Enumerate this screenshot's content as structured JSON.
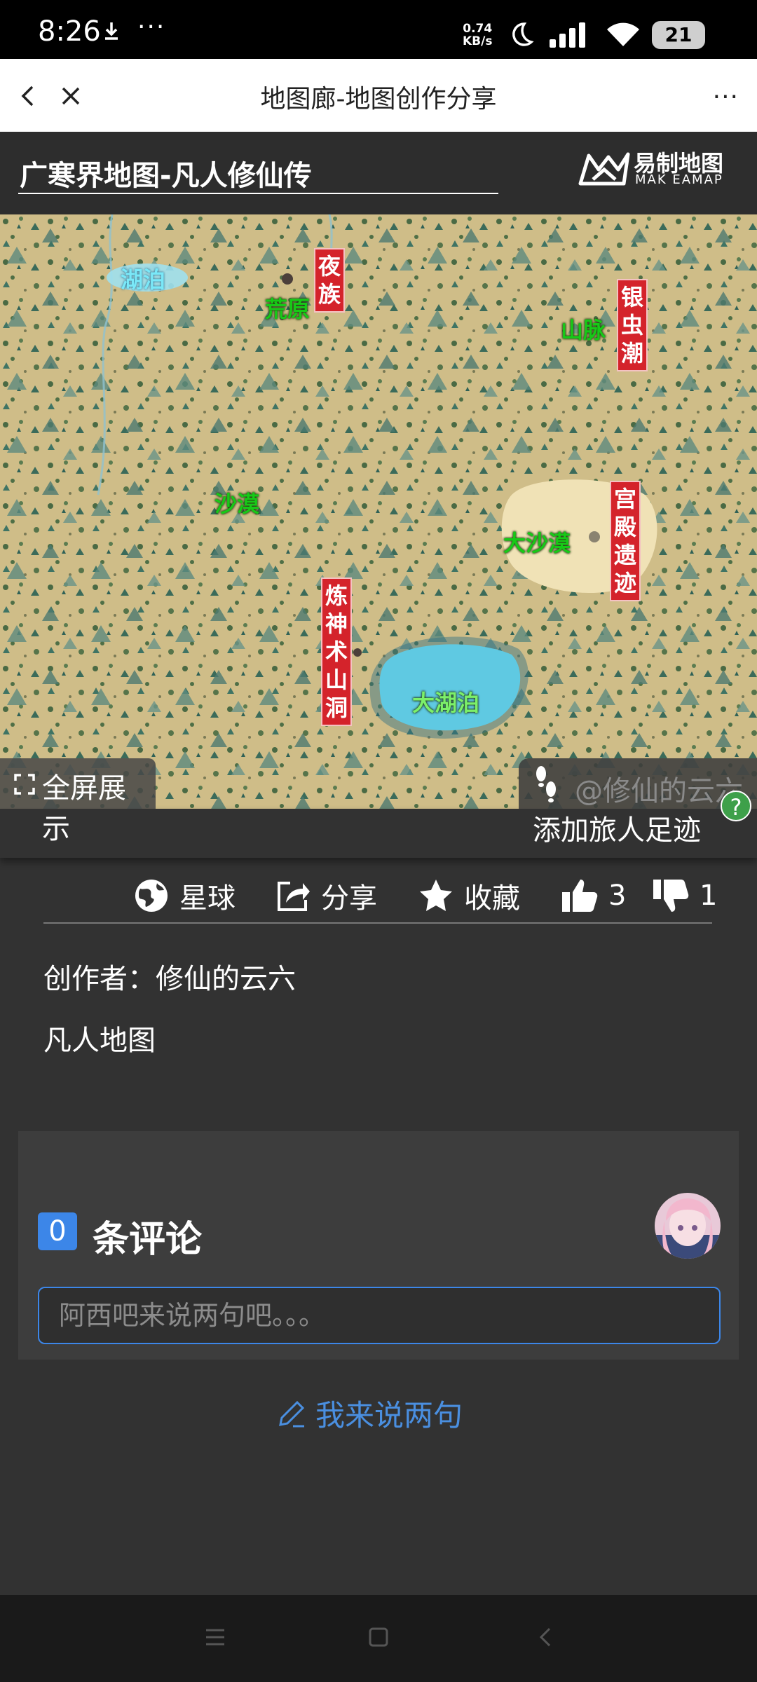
{
  "status_bar": {
    "time": "8:26",
    "net_speed_value": "0.74",
    "net_speed_unit": "KB/s",
    "battery": "21"
  },
  "nav": {
    "title": "地图廊-地图创作分享",
    "more": "···"
  },
  "map_header": {
    "title": "广寒界地图-凡人修仙传",
    "logo_cn": "易制地图",
    "logo_en": "MAK EAMAP"
  },
  "map_labels": {
    "lake_small": "湖泊",
    "wasteland": "荒原",
    "night_clan": "夜族",
    "mountain": "山脉",
    "silver_tide": "银虫潮",
    "desert": "沙漠",
    "great_desert": "大沙漠",
    "palace_ruins": "宫殿遗迹",
    "refining_cave": "炼神术山洞",
    "great_lake": "大湖泊"
  },
  "map_controls": {
    "fullscreen_line1": "全屏展",
    "fullscreen_line2": "示",
    "watermark": "@修仙的云六",
    "add_footprint": "添加旅人足迹",
    "help": "?"
  },
  "actions": {
    "planet": "星球",
    "share": "分享",
    "favorite": "收藏",
    "likes": "3",
    "dislikes": "1"
  },
  "info": {
    "author": "创作者：修仙的云六",
    "description": "凡人地图"
  },
  "comments": {
    "count": "0",
    "title": "条评论",
    "placeholder": "阿西吧来说两句吧。。。",
    "write_button": "我来说两句"
  },
  "colors": {
    "accent_blue": "#3c86e8",
    "map_label_green": "#17c917",
    "map_label_red": "#d4232b"
  }
}
